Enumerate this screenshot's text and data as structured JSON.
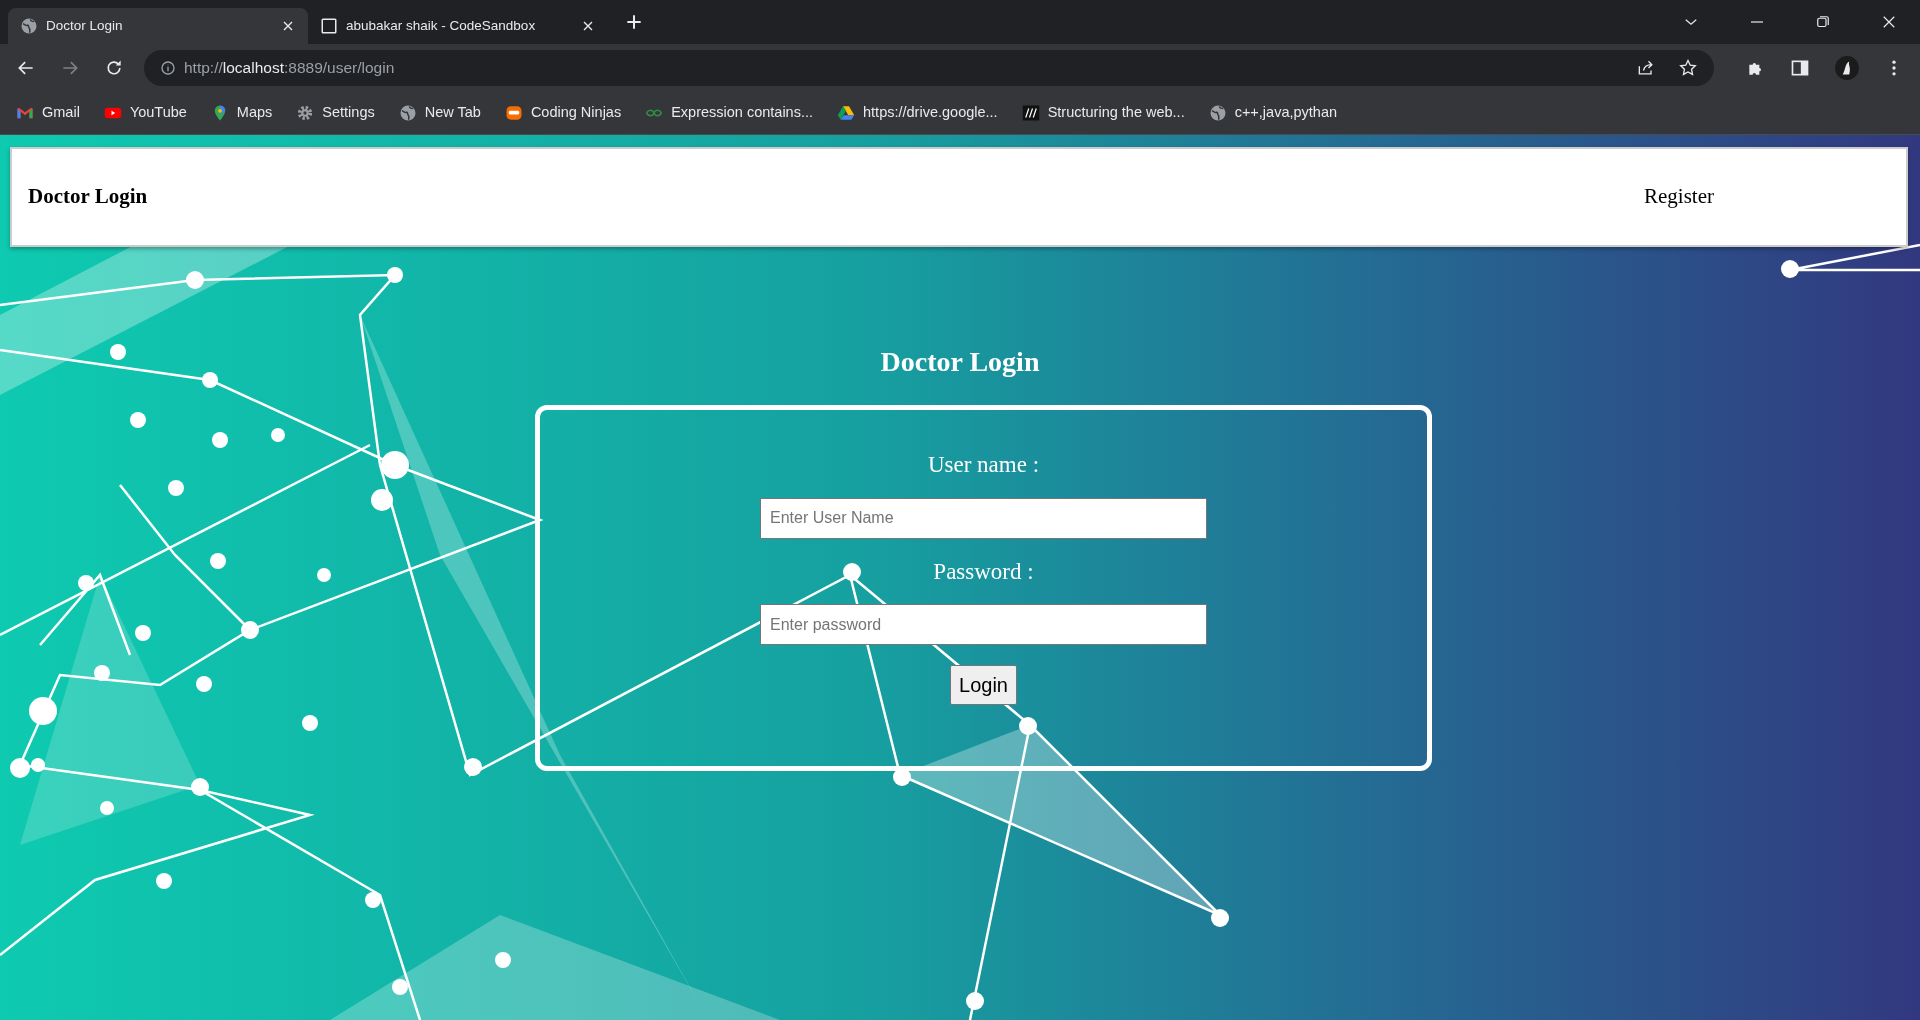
{
  "browser": {
    "tabs": [
      {
        "title": "Doctor Login",
        "selected": true
      },
      {
        "title": "abubakar shaik - CodeSandbox",
        "selected": false
      }
    ],
    "address": {
      "host": "localhost",
      "prefix": "http://",
      "suffix": ":8889/user/login"
    },
    "bookmarks": [
      "Gmail",
      "YouTube",
      "Maps",
      "Settings",
      "New Tab",
      "Coding Ninjas",
      "Expression contains...",
      "https://drive.google...",
      "Structuring the web...",
      "c++,java,pythan"
    ]
  },
  "navbar": {
    "brand": "Doctor Login",
    "links": [
      "Register"
    ]
  },
  "page": {
    "heading": "Doctor Login",
    "fields": [
      {
        "label": "User name :",
        "placeholder": "Enter User Name"
      },
      {
        "label": "Password :",
        "placeholder": "Enter password"
      }
    ],
    "button": "Login"
  }
}
